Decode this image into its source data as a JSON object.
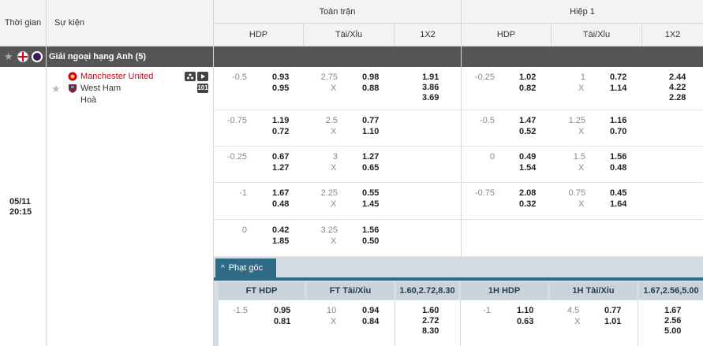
{
  "header": {
    "time": "Thời gian",
    "event": "Sự kiện",
    "full_match": "Toàn trận",
    "half1": "Hiệp 1",
    "hdp": "HDP",
    "taixiu": "Tài/Xỉu",
    "x12": "1X2"
  },
  "league": {
    "name": "Giải ngoại hạng Anh (5)"
  },
  "match": {
    "date": "05/11",
    "time": "20:15",
    "home": "Manchester United",
    "away": "West Ham",
    "draw": "Hoà",
    "home_color": "#d0021b"
  },
  "rows": [
    {
      "ft_hdp": "-0.5",
      "ft_h1": "0.93",
      "ft_h2": "0.95",
      "ft_ou": "2.75",
      "ft_x": "X",
      "ft_o1": "0.98",
      "ft_o2": "0.88",
      "ft_1x2": [
        "1.91",
        "3.86",
        "3.69"
      ],
      "h1_hdp": "-0.25",
      "h1_h1": "1.02",
      "h1_h2": "0.82",
      "h1_ou": "1",
      "h1_x": "X",
      "h1_o1": "0.72",
      "h1_o2": "1.14",
      "h1_1x2": [
        "2.44",
        "4.22",
        "2.28"
      ]
    },
    {
      "ft_hdp": "-0.75",
      "ft_h1": "1.19",
      "ft_h2": "0.72",
      "ft_ou": "2.5",
      "ft_x": "X",
      "ft_o1": "0.77",
      "ft_o2": "1.10",
      "h1_hdp": "-0.5",
      "h1_h1": "1.47",
      "h1_h2": "0.52",
      "h1_ou": "1.25",
      "h1_x": "X",
      "h1_o1": "1.16",
      "h1_o2": "0.70"
    },
    {
      "ft_hdp": "-0.25",
      "ft_h1": "0.67",
      "ft_h2": "1.27",
      "ft_ou": "3",
      "ft_x": "X",
      "ft_o1": "1.27",
      "ft_o2": "0.65",
      "h1_hdp": "0",
      "h1_h1": "0.49",
      "h1_h2": "1.54",
      "h1_ou": "1.5",
      "h1_x": "X",
      "h1_o1": "1.56",
      "h1_o2": "0.48"
    },
    {
      "ft_hdp": "-1",
      "ft_h1": "1.67",
      "ft_h2": "0.48",
      "ft_ou": "2.25",
      "ft_x": "X",
      "ft_o1": "0.55",
      "ft_o2": "1.45",
      "h1_hdp": "-0.75",
      "h1_h1": "2.08",
      "h1_h2": "0.32",
      "h1_ou": "0.75",
      "h1_x": "X",
      "h1_o1": "0.45",
      "h1_o2": "1.64"
    },
    {
      "ft_hdp": "0",
      "ft_h1": "0.42",
      "ft_h2": "1.85",
      "ft_ou": "3.25",
      "ft_x": "X",
      "ft_o1": "1.56",
      "ft_o2": "0.50"
    }
  ],
  "corner": {
    "tab": "Phạt góc",
    "ft_hdp": "FT HDP",
    "ft_taixiu": "FT Tài/Xỉu",
    "ft_1x2": [
      "1.60",
      "2.72",
      "8.30"
    ],
    "h1_hdp": "1H HDP",
    "h1_taixiu": "1H Tài/Xỉu",
    "h1_1x2": [
      "1.67",
      "2.56",
      "5.00"
    ],
    "ft_hdp_line": "-1.5",
    "ft_h1": "0.95",
    "ft_h2": "0.81",
    "ft_ou": "10",
    "ft_x": "X",
    "ft_o1": "0.94",
    "ft_o2": "0.84",
    "h1_hdp_line": "-1",
    "h1_h1": "1.10",
    "h1_h2": "0.63",
    "h1_ou": "4.5",
    "h1_x": "X",
    "h1_o1": "0.77",
    "h1_o2": "1.01"
  }
}
